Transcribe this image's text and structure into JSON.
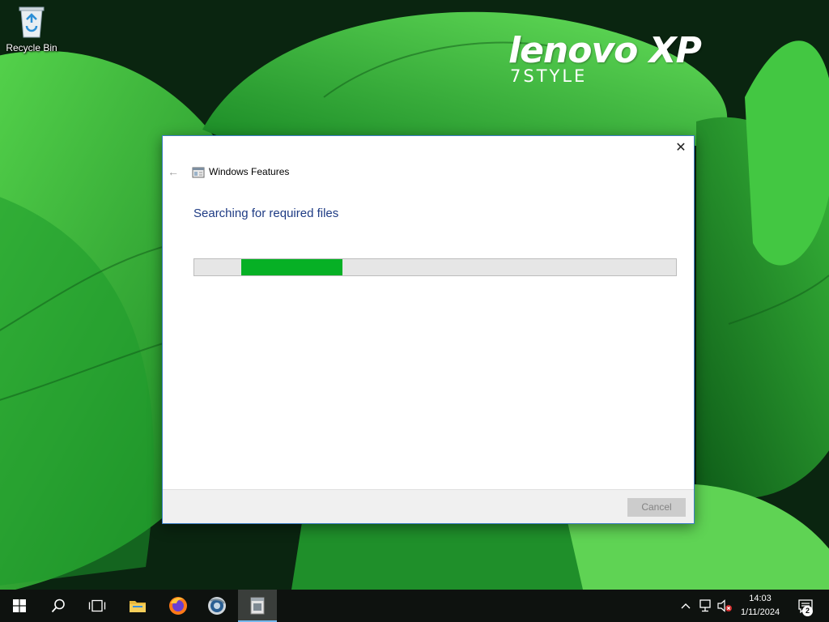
{
  "desktop": {
    "icons": [
      {
        "label": "Recycle Bin",
        "icon": "recycle-bin-icon"
      }
    ],
    "logo": {
      "brand": "lenovo XP",
      "subtitle": "7STYLE"
    }
  },
  "dialog": {
    "title": "Windows Features",
    "heading": "Searching for required files",
    "progress": 0.21,
    "cancel_label": "Cancel",
    "cancel_enabled": false,
    "close_glyph": "✕",
    "back_glyph": "←"
  },
  "taskbar": {
    "pinned": [
      {
        "name": "start-button",
        "icon": "windows-logo-icon"
      },
      {
        "name": "search-button",
        "icon": "search-icon"
      },
      {
        "name": "task-view-button",
        "icon": "task-view-icon"
      },
      {
        "name": "file-explorer-button",
        "icon": "folder-icon"
      },
      {
        "name": "firefox-button",
        "icon": "firefox-icon"
      },
      {
        "name": "browser-button",
        "icon": "globe-icon"
      },
      {
        "name": "windows-features-taskbar-button",
        "icon": "windows-features-icon",
        "active": true
      }
    ],
    "tray": {
      "time": "14:03",
      "date": "1/11/2024",
      "notification_count": "2"
    }
  },
  "colors": {
    "accent": "#0078d7",
    "progress_fill": "#06b025",
    "heading_text": "#1e3b84",
    "taskbar_bg": "#0e120f"
  }
}
